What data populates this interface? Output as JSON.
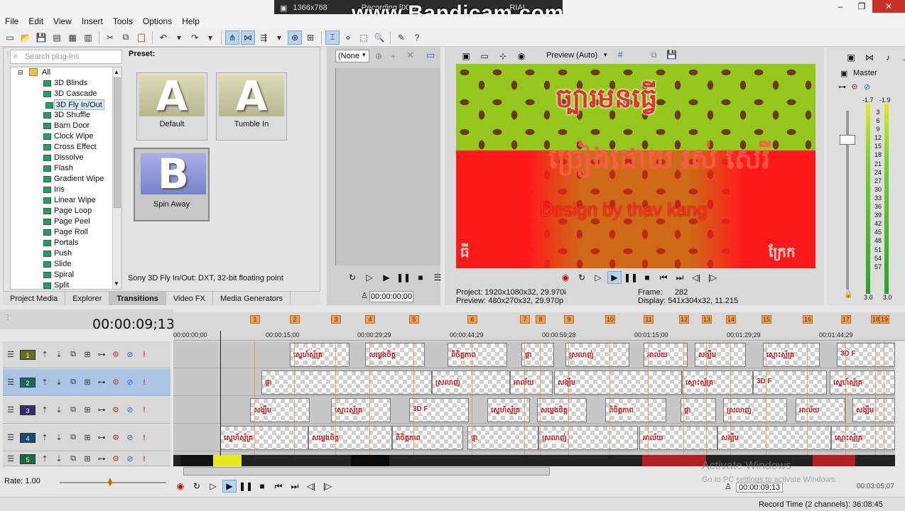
{
  "menu": [
    "File",
    "Edit",
    "View",
    "Insert",
    "Tools",
    "Options",
    "Help"
  ],
  "recorder": {
    "resolution": "1366x768",
    "status": "Recording [00:0",
    "watermark": "www.Bandicam.com",
    "title_fragment": "RIAL"
  },
  "plugins": {
    "search_placeholder": "Search plug-ins",
    "root": "All",
    "items": [
      "3D Blinds",
      "3D Cascade",
      "3D Fly In/Out",
      "3D Shuffle",
      "Barn Door",
      "Clock Wipe",
      "Cross Effect",
      "Dissolve",
      "Flash",
      "Gradient Wipe",
      "Iris",
      "Linear Wipe",
      "Page Loop",
      "Page Peel",
      "Page Roll",
      "Portals",
      "Push",
      "Slide",
      "Spiral",
      "Split"
    ],
    "selected_index": 2
  },
  "presets": {
    "label": "Preset:",
    "items": [
      {
        "name": "Default",
        "letter": "A"
      },
      {
        "name": "Tumble In",
        "letter": "A"
      },
      {
        "name": "Spin Away",
        "letter": "B"
      }
    ],
    "description": "Sony 3D Fly In/Out: DXT, 32-bit floating point"
  },
  "tabs": [
    "Project Media",
    "Explorer",
    "Transitions",
    "Video FX",
    "Media Generators"
  ],
  "active_tab": "Transitions",
  "trimmer": {
    "dropdown": "(None",
    "time": "00:00:00;00"
  },
  "preview": {
    "mode": "Preview (Auto)",
    "video_text": {
      "title": "ច្បារមនធ្វើ",
      "line2": "ច្រៀងដោយ រស់ សេរី",
      "credit": "Design by thav kang",
      "left": "ធី",
      "right": "ក្រែក"
    },
    "project_label": "Project:",
    "project": "1920x1080x32, 29.970i",
    "preview_label": "Preview:",
    "preview_value": "480x270x32, 29.970p",
    "frame_label": "Frame:",
    "frame": "282",
    "display_label": "Display:",
    "display": "541x304x32, 11.215"
  },
  "master": {
    "label": "Master",
    "peak_left": "-1.7",
    "peak_right": "-1.9",
    "scale": [
      "3",
      "6",
      "9",
      "12",
      "15",
      "18",
      "21",
      "24",
      "27",
      "30",
      "33",
      "36",
      "39",
      "42",
      "45",
      "48",
      "51",
      "54",
      "57"
    ],
    "bottom_left": "3.0",
    "bottom_right": "3.0"
  },
  "timeline": {
    "timecode": "00:00:09;13",
    "markers": [
      "1",
      "2",
      "3",
      "4",
      "5",
      "6",
      "7",
      "8",
      "9",
      "10",
      "11",
      "12",
      "13",
      "14",
      "15",
      "16",
      "17",
      "18",
      "19"
    ],
    "ruler_ticks": [
      "00:00:00;00",
      "00:00:15;00",
      "00:00:29;29",
      "00:00:44;29",
      "00:00:59;28",
      "00:01:15;00",
      "00:01:29;29",
      "00:01:44;29"
    ],
    "tracks": [
      "1",
      "2",
      "3",
      "4",
      "5"
    ],
    "rate": "Rate: 1.00",
    "cursor_time": "00:00:09;13",
    "end_time": "00:03:05;07",
    "clip_labels": [
      "ស្នេហ៍ស្ម័គ្រ",
      "សម្លេងចិត្ត",
      "ពិចិត្តភាព",
      "ផ្កា",
      "ស្រលាញ់",
      "អាល័យ",
      "សង្ឃឹម",
      "ស្មោះស្ម័គ្រ",
      "3D F"
    ]
  },
  "os": {
    "activate_title": "Activate Windows",
    "activate_sub": "Go to PC settings to activate Windows."
  },
  "status": {
    "record_time": "Record Time (2 channels): 36:08:45"
  }
}
